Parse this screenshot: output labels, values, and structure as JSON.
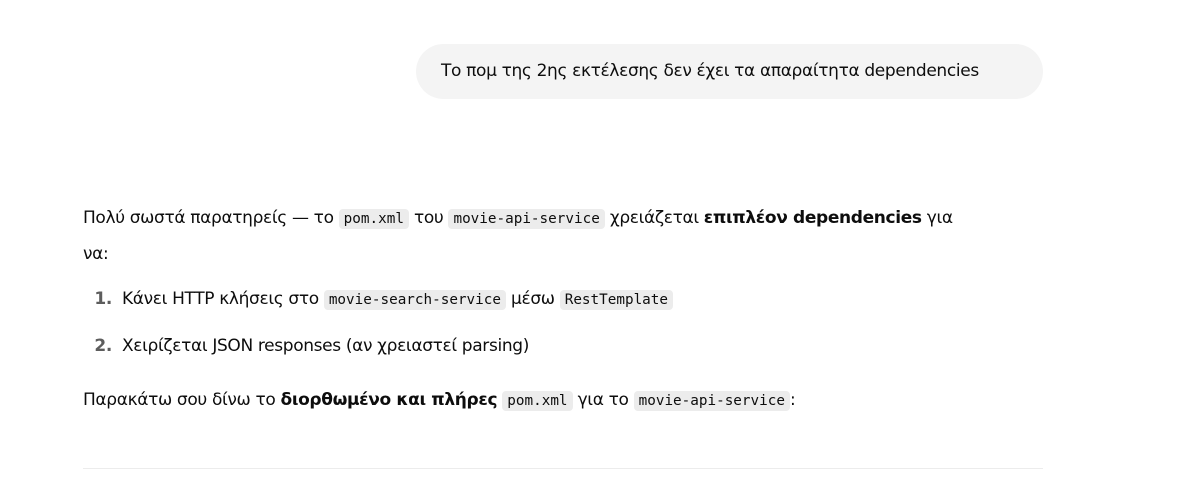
{
  "user_message": "Το πομ της 2ης εκτέλεσης δεν έχει τα απαραίτητα dependencies",
  "answer": {
    "intro_1": "Πολύ σωστά παρατηρείς — το ",
    "intro_code_1": "pom.xml",
    "intro_2": " του ",
    "intro_code_2": "movie-api-service",
    "intro_3": " χρειάζεται ",
    "intro_bold": "επιπλέον dependencies",
    "intro_4": " για",
    "intro_5": "να:",
    "list": [
      {
        "number": "1.",
        "text_1": "Κάνει HTTP κλήσεις στο ",
        "code_1": "movie-search-service",
        "text_2": " μέσω ",
        "code_2": "RestTemplate"
      },
      {
        "number": "2.",
        "text_1": "Χειρίζεται JSON responses (αν χρειαστεί parsing)"
      }
    ],
    "outro_1": "Παρακάτω σου δίνω το ",
    "outro_bold": "διορθωμένο και πλήρες",
    "outro_2": " ",
    "outro_code_1": "pom.xml",
    "outro_3": " για το ",
    "outro_code_2": "movie-api-service",
    "outro_4": ":"
  }
}
